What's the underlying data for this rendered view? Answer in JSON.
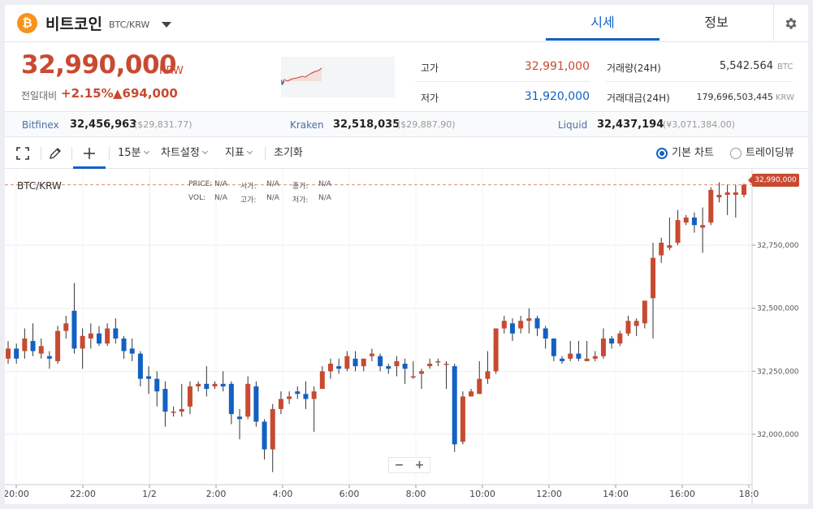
{
  "header": {
    "coin_symbol_glyph": "₿",
    "coin_name": "비트코인",
    "pair": "BTC/KRW",
    "tabs": [
      {
        "label": "시세"
      },
      {
        "label": "정보"
      }
    ]
  },
  "summary": {
    "price": "32,990,000",
    "unit": "KRW",
    "change_label": "전일대비",
    "change_pct": "+2.15%",
    "change_amt": "▲694,000",
    "high_label": "고가",
    "high": "32,991,000",
    "low_label": "저가",
    "low": "31,920,000",
    "volume_label": "거래량(24H)",
    "volume": "5,542.564",
    "volume_unit": "BTC",
    "value_label": "거래대금(24H)",
    "value": "179,696,503,445",
    "value_unit": "KRW"
  },
  "exchanges": [
    {
      "name": "Bitfinex",
      "price": "32,456,963",
      "alt": "($29,831.77)"
    },
    {
      "name": "Kraken",
      "price": "32,518,035",
      "alt": "($29,887.90)"
    },
    {
      "name": "Liquid",
      "price": "32,437,194",
      "alt": "(¥3,071,384.00)"
    }
  ],
  "toolbar": {
    "interval": "15분",
    "chart_settings": "차트설정",
    "indicators": "지표",
    "reset": "초기화",
    "view_basic": "기본 차트",
    "view_tradingview": "트레이딩뷰"
  },
  "legend": {
    "price_label": "PRICE:",
    "price": "N/A",
    "open_label": "시가:",
    "open": "N/A",
    "close_label": "종가:",
    "close": "N/A",
    "vol_label": "VOL:",
    "vol": "N/A",
    "high_label": "고가:",
    "high": "N/A",
    "low_label": "저가:",
    "low": "N/A"
  },
  "colors": {
    "up": "#c84a31",
    "down": "#1261c4",
    "accent": "#1261c4"
  },
  "chart_data": {
    "type": "candlestick",
    "title": "BTC/KRW",
    "current_price_label": "32,990,000",
    "ylim": [
      31800000,
      33050000
    ],
    "y_ticks": [
      32000000,
      32250000,
      32500000,
      32750000
    ],
    "y_tick_labels": [
      "32,000,000",
      "32,250,000",
      "32,500,000",
      "32,750,000"
    ],
    "x_ticks": [
      "20:00",
      "22:00",
      "1/2",
      "2:00",
      "4:00",
      "6:00",
      "8:00",
      "10:00",
      "12:00",
      "14:00",
      "16:00",
      "18:0"
    ],
    "candles": [
      {
        "o": 32300000,
        "h": 32370000,
        "l": 32280000,
        "c": 32340000
      },
      {
        "o": 32340000,
        "h": 32360000,
        "l": 32280000,
        "c": 32300000
      },
      {
        "o": 32330000,
        "h": 32420000,
        "l": 32300000,
        "c": 32380000
      },
      {
        "o": 32370000,
        "h": 32440000,
        "l": 32310000,
        "c": 32330000
      },
      {
        "o": 32320000,
        "h": 32380000,
        "l": 32300000,
        "c": 32350000
      },
      {
        "o": 32310000,
        "h": 32330000,
        "l": 32260000,
        "c": 32300000
      },
      {
        "o": 32290000,
        "h": 32430000,
        "l": 32280000,
        "c": 32410000
      },
      {
        "o": 32410000,
        "h": 32470000,
        "l": 32380000,
        "c": 32440000
      },
      {
        "o": 32490000,
        "h": 32600000,
        "l": 32320000,
        "c": 32340000
      },
      {
        "o": 32340000,
        "h": 32420000,
        "l": 32260000,
        "c": 32390000
      },
      {
        "o": 32380000,
        "h": 32440000,
        "l": 32340000,
        "c": 32400000
      },
      {
        "o": 32400000,
        "h": 32430000,
        "l": 32350000,
        "c": 32360000
      },
      {
        "o": 32360000,
        "h": 32440000,
        "l": 32350000,
        "c": 32420000
      },
      {
        "o": 32420000,
        "h": 32460000,
        "l": 32360000,
        "c": 32380000
      },
      {
        "o": 32380000,
        "h": 32390000,
        "l": 32300000,
        "c": 32330000
      },
      {
        "o": 32340000,
        "h": 32380000,
        "l": 32290000,
        "c": 32320000
      },
      {
        "o": 32320000,
        "h": 32330000,
        "l": 32190000,
        "c": 32220000
      },
      {
        "o": 32230000,
        "h": 32270000,
        "l": 32160000,
        "c": 32220000
      },
      {
        "o": 32220000,
        "h": 32250000,
        "l": 32110000,
        "c": 32170000
      },
      {
        "o": 32180000,
        "h": 32210000,
        "l": 32030000,
        "c": 32090000
      },
      {
        "o": 32090000,
        "h": 32110000,
        "l": 32070000,
        "c": 32090000
      },
      {
        "o": 32090000,
        "h": 32200000,
        "l": 32070000,
        "c": 32100000
      },
      {
        "o": 32110000,
        "h": 32210000,
        "l": 32080000,
        "c": 32190000
      },
      {
        "o": 32190000,
        "h": 32210000,
        "l": 32170000,
        "c": 32200000
      },
      {
        "o": 32200000,
        "h": 32270000,
        "l": 32150000,
        "c": 32180000
      },
      {
        "o": 32190000,
        "h": 32210000,
        "l": 32180000,
        "c": 32200000
      },
      {
        "o": 32200000,
        "h": 32250000,
        "l": 32170000,
        "c": 32190000
      },
      {
        "o": 32200000,
        "h": 32210000,
        "l": 32040000,
        "c": 32080000
      },
      {
        "o": 32070000,
        "h": 32100000,
        "l": 31980000,
        "c": 32060000
      },
      {
        "o": 32070000,
        "h": 32230000,
        "l": 32060000,
        "c": 32200000
      },
      {
        "o": 32190000,
        "h": 32210000,
        "l": 32030000,
        "c": 32050000
      },
      {
        "o": 32050000,
        "h": 32060000,
        "l": 31900000,
        "c": 31940000
      },
      {
        "o": 31940000,
        "h": 32120000,
        "l": 31850000,
        "c": 32100000
      },
      {
        "o": 32100000,
        "h": 32170000,
        "l": 32080000,
        "c": 32140000
      },
      {
        "o": 32140000,
        "h": 32170000,
        "l": 32120000,
        "c": 32150000
      },
      {
        "o": 32170000,
        "h": 32190000,
        "l": 32140000,
        "c": 32160000
      },
      {
        "o": 32160000,
        "h": 32210000,
        "l": 32100000,
        "c": 32140000
      },
      {
        "o": 32140000,
        "h": 32190000,
        "l": 32010000,
        "c": 32170000
      },
      {
        "o": 32180000,
        "h": 32270000,
        "l": 32180000,
        "c": 32250000
      },
      {
        "o": 32250000,
        "h": 32300000,
        "l": 32220000,
        "c": 32280000
      },
      {
        "o": 32270000,
        "h": 32300000,
        "l": 32240000,
        "c": 32260000
      },
      {
        "o": 32260000,
        "h": 32330000,
        "l": 32250000,
        "c": 32310000
      },
      {
        "o": 32300000,
        "h": 32330000,
        "l": 32250000,
        "c": 32270000
      },
      {
        "o": 32270000,
        "h": 32300000,
        "l": 32250000,
        "c": 32300000
      },
      {
        "o": 32310000,
        "h": 32340000,
        "l": 32290000,
        "c": 32320000
      },
      {
        "o": 32310000,
        "h": 32320000,
        "l": 32250000,
        "c": 32270000
      },
      {
        "o": 32270000,
        "h": 32280000,
        "l": 32240000,
        "c": 32260000
      },
      {
        "o": 32270000,
        "h": 32310000,
        "l": 32230000,
        "c": 32290000
      },
      {
        "o": 32280000,
        "h": 32300000,
        "l": 32200000,
        "c": 32260000
      },
      {
        "o": 32230000,
        "h": 32290000,
        "l": 32220000,
        "c": 32230000
      },
      {
        "o": 32240000,
        "h": 32260000,
        "l": 32180000,
        "c": 32250000
      },
      {
        "o": 32270000,
        "h": 32300000,
        "l": 32260000,
        "c": 32280000
      },
      {
        "o": 32290000,
        "h": 32300000,
        "l": 32270000,
        "c": 32290000
      },
      {
        "o": 32280000,
        "h": 32290000,
        "l": 32180000,
        "c": 32280000
      },
      {
        "o": 32270000,
        "h": 32280000,
        "l": 31930000,
        "c": 31960000
      },
      {
        "o": 31970000,
        "h": 32170000,
        "l": 31960000,
        "c": 32150000
      },
      {
        "o": 32150000,
        "h": 32180000,
        "l": 32150000,
        "c": 32170000
      },
      {
        "o": 32160000,
        "h": 32290000,
        "l": 32160000,
        "c": 32220000
      },
      {
        "o": 32220000,
        "h": 32330000,
        "l": 32200000,
        "c": 32250000
      },
      {
        "o": 32250000,
        "h": 32420000,
        "l": 32240000,
        "c": 32420000
      },
      {
        "o": 32420000,
        "h": 32470000,
        "l": 32400000,
        "c": 32450000
      },
      {
        "o": 32440000,
        "h": 32460000,
        "l": 32370000,
        "c": 32400000
      },
      {
        "o": 32420000,
        "h": 32470000,
        "l": 32400000,
        "c": 32450000
      },
      {
        "o": 32450000,
        "h": 32500000,
        "l": 32400000,
        "c": 32460000
      },
      {
        "o": 32460000,
        "h": 32470000,
        "l": 32390000,
        "c": 32420000
      },
      {
        "o": 32420000,
        "h": 32430000,
        "l": 32340000,
        "c": 32380000
      },
      {
        "o": 32380000,
        "h": 32380000,
        "l": 32290000,
        "c": 32310000
      },
      {
        "o": 32300000,
        "h": 32310000,
        "l": 32280000,
        "c": 32290000
      },
      {
        "o": 32300000,
        "h": 32370000,
        "l": 32290000,
        "c": 32320000
      },
      {
        "o": 32320000,
        "h": 32370000,
        "l": 32290000,
        "c": 32300000
      },
      {
        "o": 32290000,
        "h": 32370000,
        "l": 32290000,
        "c": 32300000
      },
      {
        "o": 32300000,
        "h": 32330000,
        "l": 32290000,
        "c": 32310000
      },
      {
        "o": 32310000,
        "h": 32420000,
        "l": 32300000,
        "c": 32380000
      },
      {
        "o": 32380000,
        "h": 32390000,
        "l": 32340000,
        "c": 32360000
      },
      {
        "o": 32360000,
        "h": 32410000,
        "l": 32350000,
        "c": 32400000
      },
      {
        "o": 32400000,
        "h": 32470000,
        "l": 32390000,
        "c": 32450000
      },
      {
        "o": 32430000,
        "h": 32460000,
        "l": 32390000,
        "c": 32450000
      },
      {
        "o": 32440000,
        "h": 32530000,
        "l": 32420000,
        "c": 32530000
      },
      {
        "o": 32540000,
        "h": 32760000,
        "l": 32380000,
        "c": 32700000
      },
      {
        "o": 32710000,
        "h": 32780000,
        "l": 32680000,
        "c": 32760000
      },
      {
        "o": 32740000,
        "h": 32860000,
        "l": 32730000,
        "c": 32750000
      },
      {
        "o": 32760000,
        "h": 32890000,
        "l": 32750000,
        "c": 32850000
      },
      {
        "o": 32840000,
        "h": 32870000,
        "l": 32830000,
        "c": 32860000
      },
      {
        "o": 32860000,
        "h": 32880000,
        "l": 32800000,
        "c": 32830000
      },
      {
        "o": 32820000,
        "h": 32900000,
        "l": 32720000,
        "c": 32830000
      },
      {
        "o": 32840000,
        "h": 32980000,
        "l": 32830000,
        "c": 32970000
      },
      {
        "o": 32940000,
        "h": 33000000,
        "l": 32920000,
        "c": 32950000
      },
      {
        "o": 32950000,
        "h": 32990000,
        "l": 32870000,
        "c": 32960000
      },
      {
        "o": 32950000,
        "h": 32990000,
        "l": 32860000,
        "c": 32960000
      },
      {
        "o": 32950000,
        "h": 32995000,
        "l": 32940000,
        "c": 32990000
      }
    ]
  }
}
